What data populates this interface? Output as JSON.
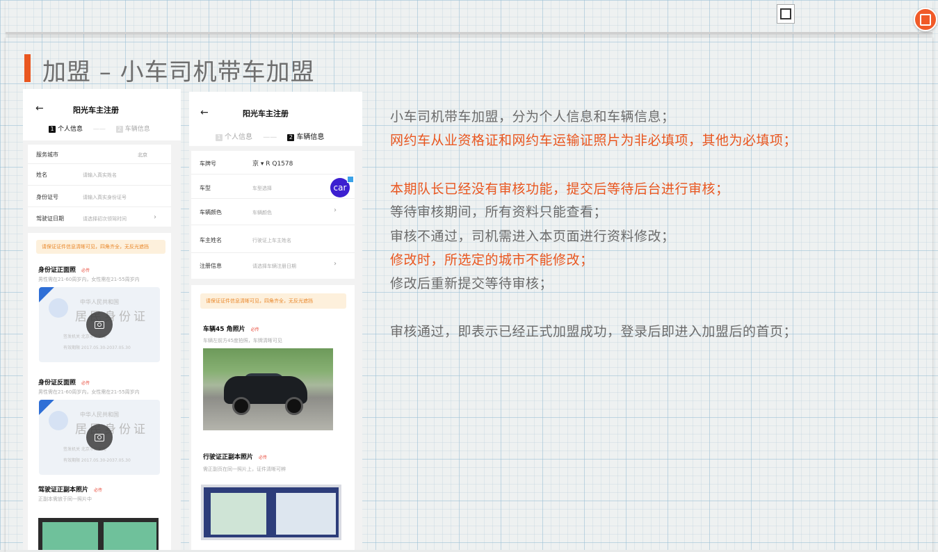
{
  "page_title": "加盟 – 小车司机带车加盟",
  "colors": {
    "accent": "#e9561f",
    "notice_bg": "#fdf0dc",
    "notice_text": "#e9872a"
  },
  "icons": {
    "top_thumbnail": "image-frame-icon",
    "corner_button": "slides-icon"
  },
  "phone1": {
    "back_glyph": "←",
    "title": "阳光车主注册",
    "steps": [
      {
        "num": "1",
        "label": "个人信息"
      },
      {
        "num": "2",
        "label": "车辆信息"
      }
    ],
    "step_sep": "——",
    "fields": [
      {
        "label": "服务城市",
        "value": "北京"
      },
      {
        "label": "姓名",
        "placeholder": "请输入真实姓名"
      },
      {
        "label": "身份证号",
        "placeholder": "请输入真实身份证号"
      },
      {
        "label": "驾驶证日期",
        "placeholder": "请选择初次领驾时间",
        "chevron": "›"
      }
    ],
    "notice": "请保证证件信息清晰可见，四角齐全，无反光遮挡",
    "sections": [
      {
        "title": "身份证正面照",
        "required": "必传",
        "desc": "男性需在21-60周岁内，女性需在21-55周岁内",
        "card": {
          "header": "中华人民共和国",
          "big": "居民身份证",
          "line1": "签发机关  北京市公安局",
          "line2": "有效期限  2017.05.30-2037.05.30"
        }
      },
      {
        "title": "身份证反面照",
        "required": "必传",
        "desc": "男性需在21-60周岁内，女性需在21-55周岁内",
        "card": {
          "header": "中华人民共和国",
          "big": "居民身份证",
          "line1": "签发机关  北京市公安局",
          "line2": "有效期限  2017.05.30-2037.05.30"
        }
      },
      {
        "title": "驾驶证正副本照片",
        "required": "必传",
        "desc": "正副本需放于同一照片中"
      }
    ]
  },
  "phone2": {
    "back_glyph": "←",
    "title": "阳光车主注册",
    "steps": [
      {
        "num": "1",
        "label": "个人信息"
      },
      {
        "num": "2",
        "label": "车辆信息"
      }
    ],
    "step_sep": "——",
    "fields": [
      {
        "label": "车牌号",
        "value": "京 ▾   R Q1578"
      },
      {
        "label": "车型",
        "placeholder": "车型选择"
      },
      {
        "label": "车辆颜色",
        "placeholder": "车辆颜色",
        "chevron": "›"
      },
      {
        "label": "车主姓名",
        "placeholder": "行驶证上车主姓名"
      },
      {
        "label": "注册信息",
        "placeholder": "请选择车辆注册日期",
        "chevron": "›"
      }
    ],
    "car_logo_text": "car",
    "notice": "请保证证件信息清晰可见，四角齐全，无反光遮挡",
    "sections": [
      {
        "title": "车辆45 角照片",
        "required": "必传",
        "desc": "车辆左前方45度拍照，车牌清晰可见"
      },
      {
        "title": "行驶证正副本照片",
        "required": "必传",
        "desc": "需正副页在同一照片上，证件清晰可辨"
      }
    ]
  },
  "description": [
    {
      "text": "小车司机带车加盟，分为个人信息和车辆信息；",
      "color": "gray"
    },
    {
      "text": "网约车从业资格证和网约车运输证照片为非必填项，其他为必填项；",
      "color": "orange"
    },
    {
      "text": "",
      "color": "gray"
    },
    {
      "text": "本期队长已经没有审核功能，提交后等待后台进行审核；",
      "color": "orange"
    },
    {
      "text": "等待审核期间，所有资料只能查看；",
      "color": "gray"
    },
    {
      "text": "审核不通过，司机需进入本页面进行资料修改；",
      "color": "gray"
    },
    {
      "text": "修改时，所选定的城市不能修改；",
      "color": "orange"
    },
    {
      "text": "修改后重新提交等待审核；",
      "color": "gray"
    },
    {
      "text": "",
      "color": "gray"
    },
    {
      "text": "审核通过，即表示已经正式加盟成功，登录后即进入加盟后的首页；",
      "color": "gray"
    }
  ]
}
